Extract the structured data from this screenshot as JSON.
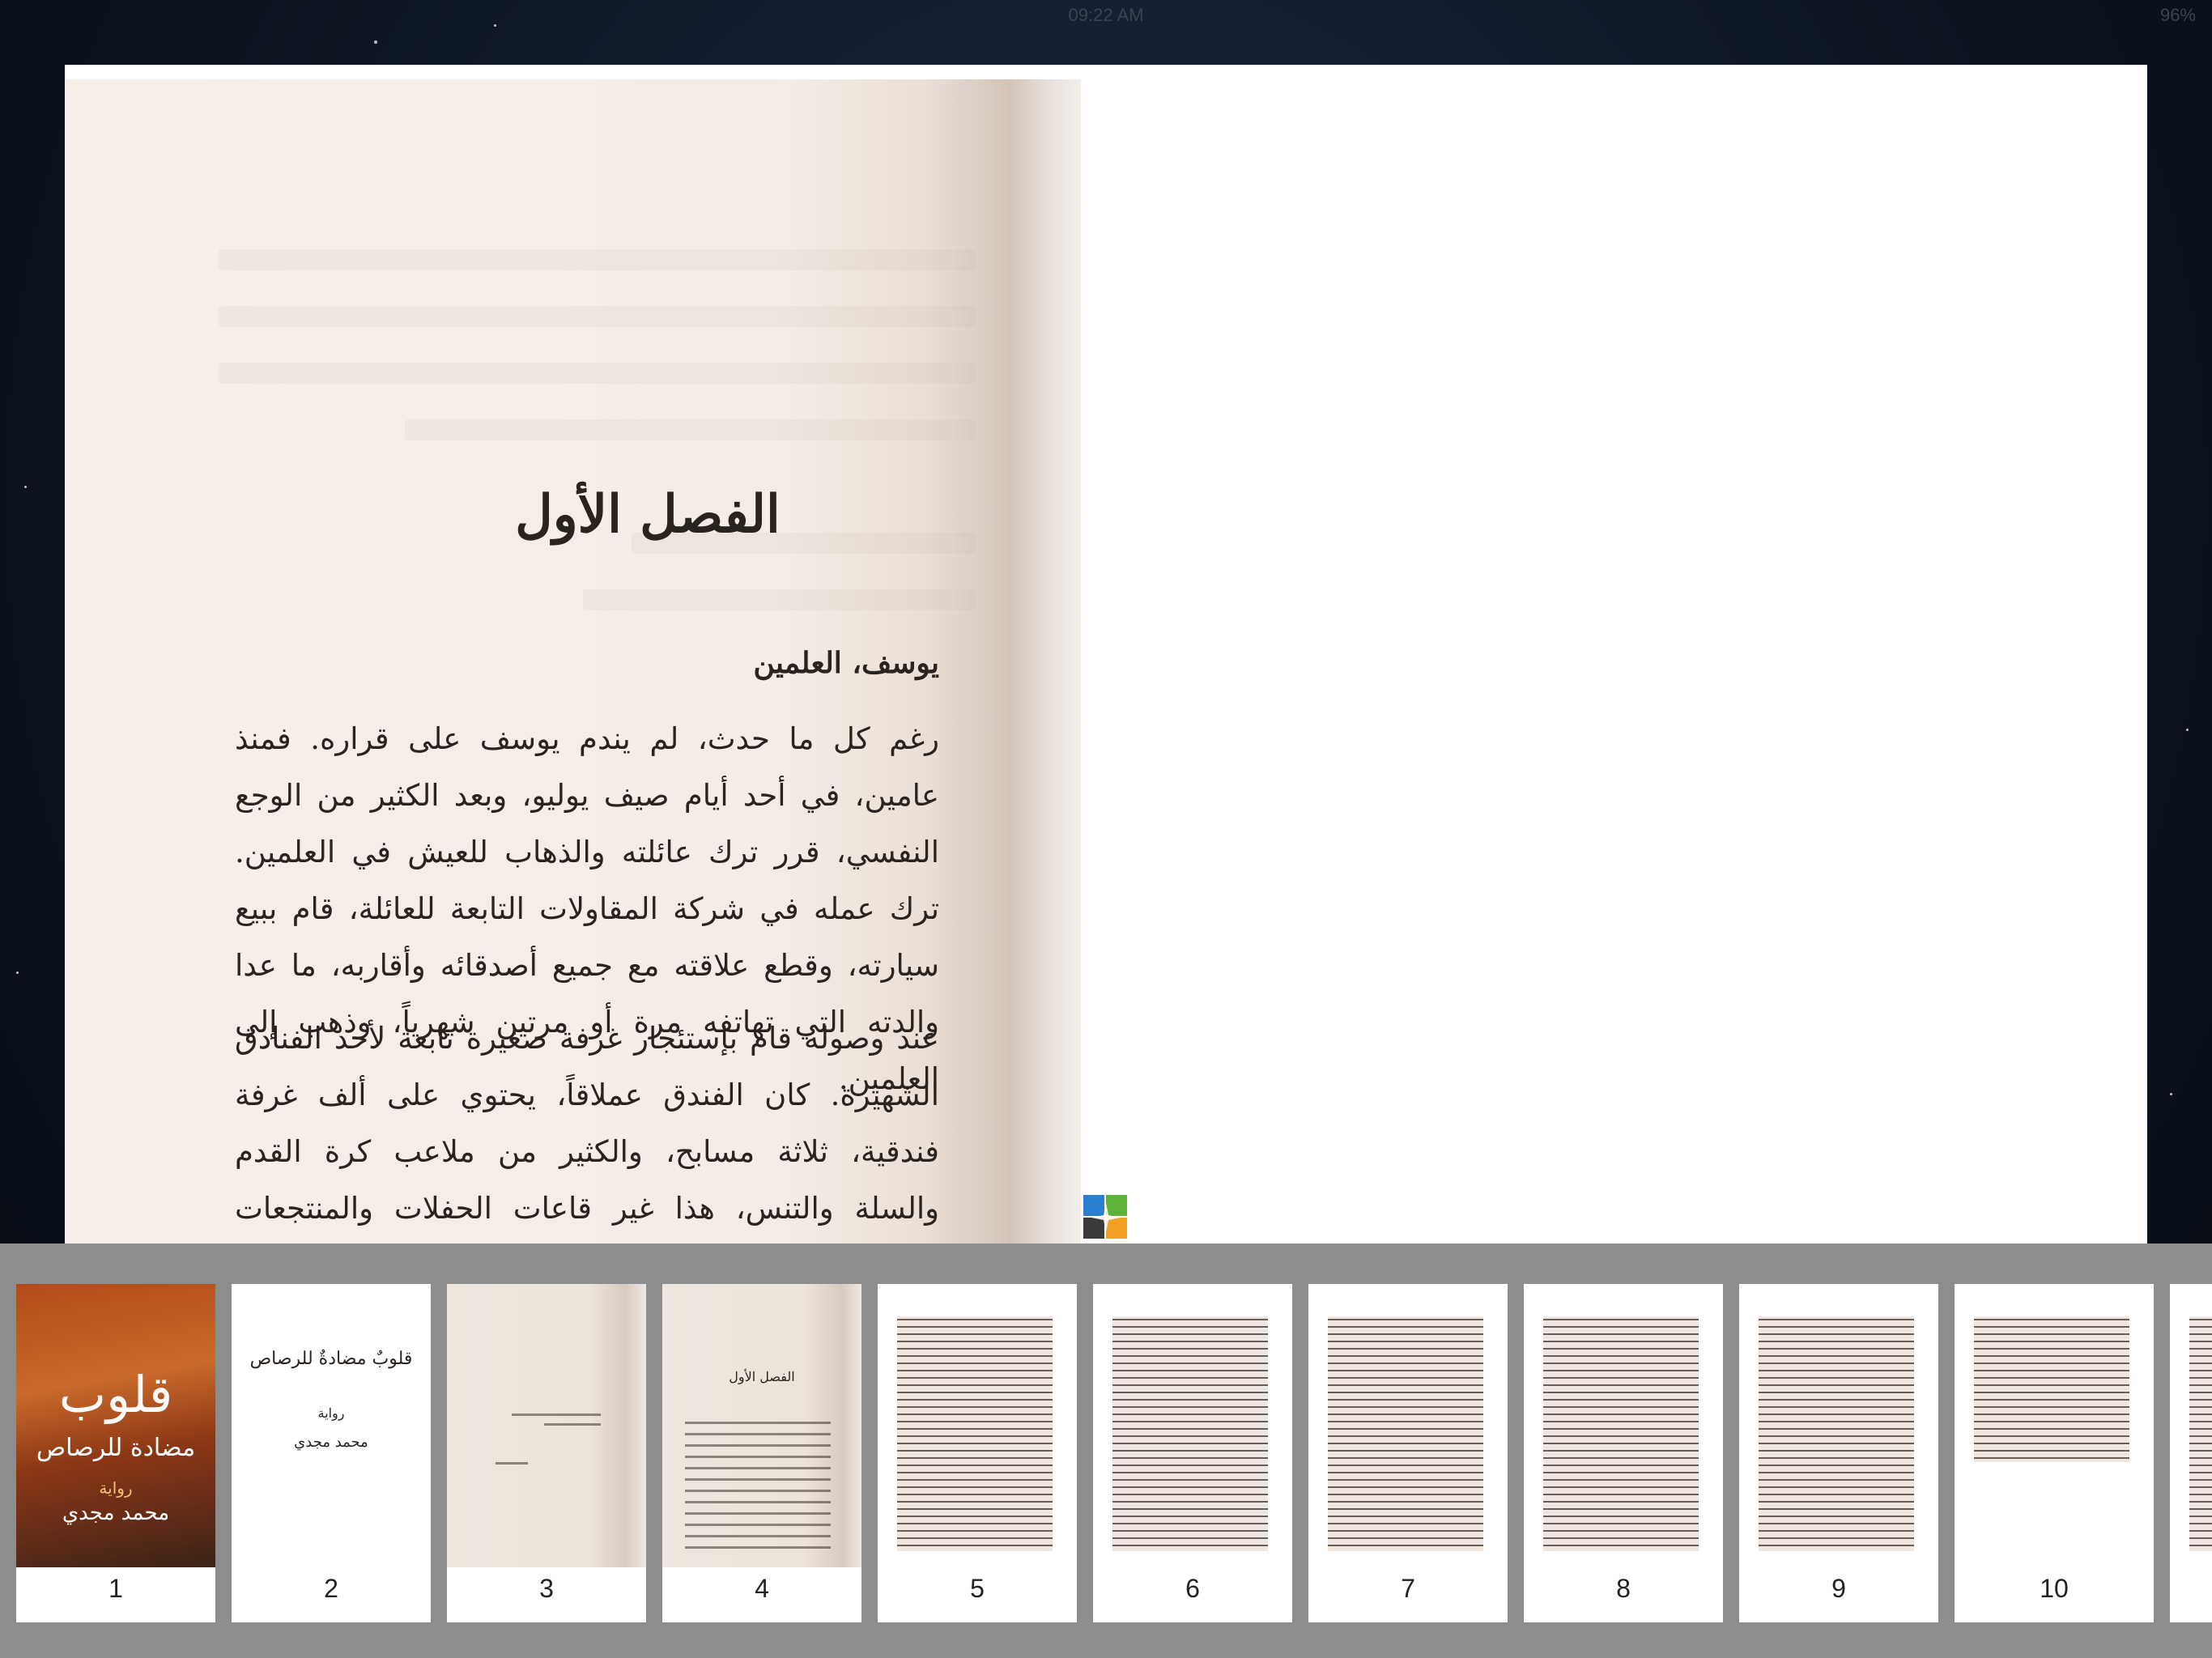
{
  "status_bar": {
    "time": "09:22 AM",
    "battery": "96%"
  },
  "page": {
    "chapter_title": "الفصل الأول",
    "section_heading": "يوسف، العلمين",
    "paragraphs": [
      "رغم كل ما حدث، لم يندم يوسف على قراره. فمنذ عامين، في أحد أيام صيف يوليو، وبعد الكثير من الوجع النفسي، قرر ترك عائلته والذهاب للعيش في العلمين. ترك عمله في شركة المقاولات التابعة للعائلة، قام ببيع سيارته، وقطع علاقته مع جميع أصدقائه وأقاربه، ما عدا والدته التي تهاتفه مرة أو مرتين شهرياً، وذهب إلى العلمين.",
      "عند وصوله قام بإستئجار غرفة صغيرة تابعة لأحد الفنادق الشهيرة. كان الفندق عملاقاً، يحتوي على ألف غرفة فندقية، ثلاثة مسابح، والكثير من ملاعب كرة القدم والسلة والتنس، هذا غير قاعات الحفلات والمنتجعات الصحية وصالات الجيم."
    ]
  },
  "thumbnails": {
    "cover": {
      "title": "قلوب",
      "subtitle": "مضادة للرصاص",
      "genre": "رواية",
      "author": "محمد مجدي"
    },
    "title_page": {
      "title": "قلوبٌ مضادةٌ للرصاص",
      "genre": "رواية",
      "author": "محمد مجدي"
    },
    "chapter_thumb_title": "الفصل الأول",
    "items": [
      {
        "number": "1"
      },
      {
        "number": "2"
      },
      {
        "number": "3"
      },
      {
        "number": "4"
      },
      {
        "number": "5"
      },
      {
        "number": "6"
      },
      {
        "number": "7"
      },
      {
        "number": "8"
      },
      {
        "number": "9"
      },
      {
        "number": "10"
      },
      {
        "number": ""
      }
    ]
  },
  "colors": {
    "background": "#0e1623",
    "page_paper": "#f4ede6",
    "thumb_strip": "#8d8d8d",
    "cover_orange": "#c96a2c"
  }
}
